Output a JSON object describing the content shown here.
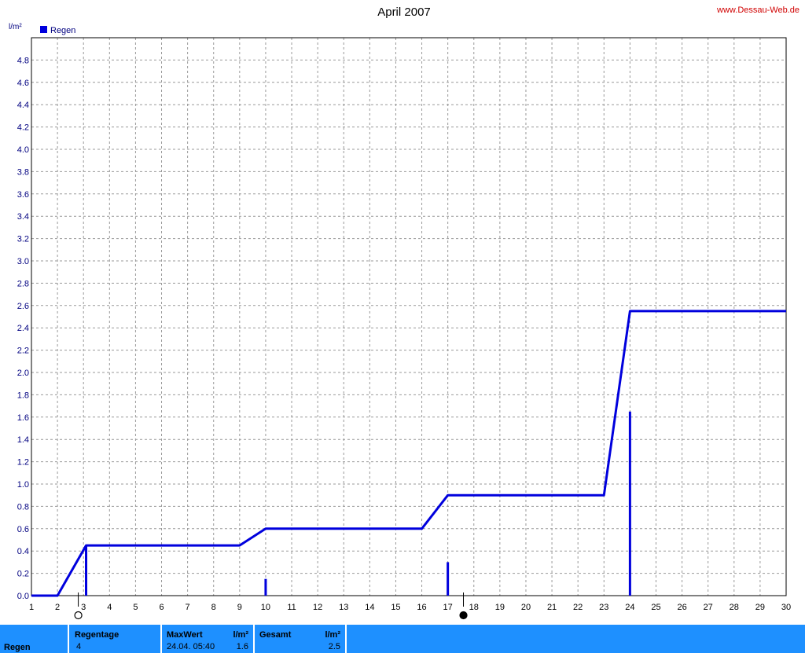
{
  "header": {
    "title": "April 2007",
    "site": "www.Dessau-Web.de",
    "unit": "l/m²",
    "legend_label": "Regen"
  },
  "colors": {
    "series": "#0000dd",
    "grid": "#999999",
    "axis_text": "#000080",
    "site_text": "#d00000",
    "stats_bg": "#1e90ff"
  },
  "chart_data": {
    "type": "line",
    "title": "April 2007",
    "xlabel": "",
    "ylabel": "l/m²",
    "xlim": [
      1,
      30
    ],
    "ylim": [
      0,
      5.0
    ],
    "grid": true,
    "legend": "top-left",
    "x_ticks": [
      1,
      2,
      3,
      4,
      5,
      6,
      7,
      8,
      9,
      10,
      11,
      12,
      13,
      14,
      15,
      16,
      17,
      18,
      19,
      20,
      21,
      22,
      23,
      24,
      25,
      26,
      27,
      28,
      29,
      30
    ],
    "y_ticks": [
      "0.0",
      "0.2",
      "0.4",
      "0.6",
      "0.8",
      "1.0",
      "1.2",
      "1.4",
      "1.6",
      "1.8",
      "2.0",
      "2.2",
      "2.4",
      "2.6",
      "2.8",
      "3.0",
      "3.2",
      "3.4",
      "3.6",
      "3.8",
      "4.0",
      "4.2",
      "4.4",
      "4.6",
      "4.8"
    ],
    "series": [
      {
        "name": "Regen",
        "kind": "cumulative",
        "x": [
          1,
          2,
          3.1,
          9,
          10,
          16,
          17,
          23,
          24,
          30
        ],
        "y": [
          0,
          0,
          0.45,
          0.45,
          0.6,
          0.6,
          0.9,
          0.9,
          2.55,
          2.55
        ]
      },
      {
        "kind": "daily",
        "x": [
          3.1,
          10,
          17,
          24
        ],
        "y": [
          0.45,
          0.15,
          0.3,
          1.65
        ]
      }
    ],
    "moon_phases": [
      {
        "x": 2.8,
        "phase": "full-moon"
      },
      {
        "x": 17.6,
        "phase": "new-moon"
      }
    ]
  },
  "stats": {
    "row_label": "Regen",
    "regentage_label": "Regentage",
    "regentage_value": "4",
    "maxwert_label": "MaxWert",
    "maxwert_unit": "l/m²",
    "maxwert_date": "24.04.  05:40",
    "maxwert_value": "1.6",
    "gesamt_label": "Gesamt",
    "gesamt_unit": "l/m²",
    "gesamt_value": "2.5"
  }
}
